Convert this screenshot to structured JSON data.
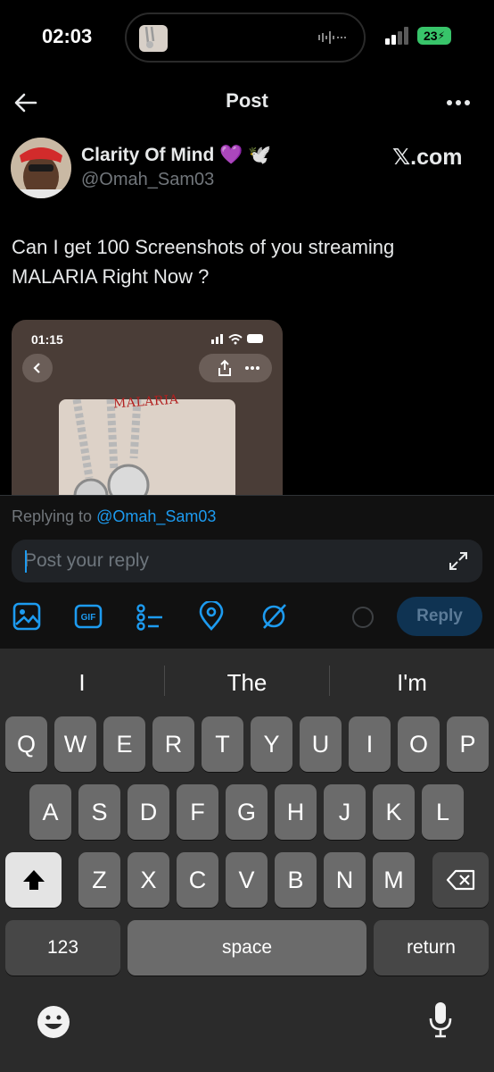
{
  "status_bar": {
    "time": "02:03",
    "battery": "23"
  },
  "header": {
    "title": "Post"
  },
  "post": {
    "author_name": "Clarity Of Mind 💜 🕊️",
    "author_handle": "@Omah_Sam03",
    "source_tag": "𝕏.com",
    "text": "Can I get 100 Screenshots of you streaming MALARIA Right Now ?",
    "embed": {
      "time": "01:15",
      "cover_title": "MALARIA"
    }
  },
  "composer": {
    "replying_prefix": "Replying to",
    "replying_handle": "@Omah_Sam03",
    "placeholder": "Post your reply",
    "reply_label": "Reply",
    "tools": [
      "image-icon",
      "gif-icon",
      "poll-icon",
      "location-icon",
      "grok-icon"
    ]
  },
  "keyboard": {
    "suggestions": [
      "I",
      "The",
      "I'm"
    ],
    "row1": [
      "Q",
      "W",
      "E",
      "R",
      "T",
      "Y",
      "U",
      "I",
      "O",
      "P"
    ],
    "row2": [
      "A",
      "S",
      "D",
      "F",
      "G",
      "H",
      "J",
      "K",
      "L"
    ],
    "row3": [
      "Z",
      "X",
      "C",
      "V",
      "B",
      "N",
      "M"
    ],
    "numbers_label": "123",
    "space_label": "space",
    "return_label": "return"
  },
  "colors": {
    "accent": "#1d9bf0",
    "background": "#000000",
    "keyboard": "#2b2b2b"
  }
}
